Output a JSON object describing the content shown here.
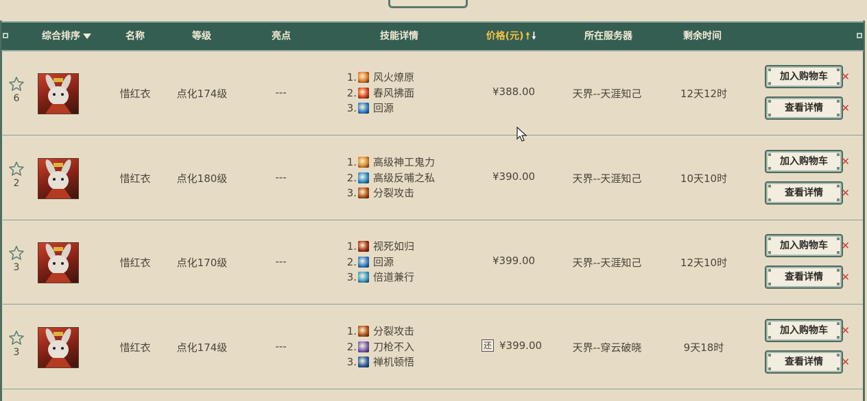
{
  "table": {
    "headers": {
      "sort": "综合排序",
      "name": "名称",
      "level": "等级",
      "highlight": "亮点",
      "skills": "技能详情",
      "price": "价格(元)",
      "server": "所在服务器",
      "remaining": "剩余时间"
    },
    "sort_icons": {
      "sort_dropdown": "caret-down-icon",
      "price_up": "arrow-up-icon",
      "price_down": "arrow-down-icon"
    },
    "accent_colors": {
      "header_bg": "#355e52",
      "price_header": "#f4c344",
      "tick": "#d03b2b"
    },
    "rows": [
      {
        "fav_count": "6",
        "name": "惜红衣",
        "level": "点化174级",
        "highlight": "---",
        "skills": [
          {
            "num": "1.",
            "name": "风火燎原",
            "icon": "fire-wind-skill-icon",
            "color": "#e07a2a"
          },
          {
            "num": "2.",
            "name": "春风拂面",
            "icon": "flame-skill-icon",
            "color": "#d9451d"
          },
          {
            "num": "3.",
            "name": "回源",
            "icon": "orb-skill-icon",
            "color": "#2f7fd0"
          }
        ],
        "returnable": "",
        "price": "¥388.00",
        "server": "天界--天涯知己",
        "remaining": "12天12时",
        "add_cart": "加入购物车",
        "view": "查看详情"
      },
      {
        "fav_count": "2",
        "name": "惜红衣",
        "level": "点化180级",
        "highlight": "---",
        "skills": [
          {
            "num": "1.",
            "name": "高级神工鬼力",
            "icon": "fist-skill-icon",
            "color": "#e0872f"
          },
          {
            "num": "2.",
            "name": "高级反哺之私",
            "icon": "water-skill-icon",
            "color": "#2a8fd8"
          },
          {
            "num": "3.",
            "name": "分裂攻击",
            "icon": "split-attack-skill-icon",
            "color": "#b3541a"
          }
        ],
        "returnable": "",
        "price": "¥390.00",
        "server": "天界--天涯知己",
        "remaining": "10天10时",
        "add_cart": "加入购物车",
        "view": "查看详情"
      },
      {
        "fav_count": "3",
        "name": "惜红衣",
        "level": "点化170级",
        "highlight": "---",
        "skills": [
          {
            "num": "1.",
            "name": "视死如归",
            "icon": "skull-skill-icon",
            "color": "#a8321e"
          },
          {
            "num": "2.",
            "name": "回源",
            "icon": "orb-skill-icon",
            "color": "#2f7fd0"
          },
          {
            "num": "3.",
            "name": "倍道兼行",
            "icon": "speed-skill-icon",
            "color": "#3a9fd0"
          }
        ],
        "returnable": "",
        "price": "¥399.00",
        "server": "天界--天涯知己",
        "remaining": "12天10时",
        "add_cart": "加入购物车",
        "view": "查看详情"
      },
      {
        "fav_count": "3",
        "name": "惜红衣",
        "level": "点化174级",
        "highlight": "---",
        "skills": [
          {
            "num": "1.",
            "name": "分裂攻击",
            "icon": "split-attack-skill-icon",
            "color": "#b3541a"
          },
          {
            "num": "2.",
            "name": "刀枪不入",
            "icon": "shield-skill-icon",
            "color": "#7b5fb8"
          },
          {
            "num": "3.",
            "name": "禅机顿悟",
            "icon": "meditation-skill-icon",
            "color": "#2b5fa8"
          }
        ],
        "returnable": "还",
        "price": "¥399.00",
        "server": "天界--穿云破晓",
        "remaining": "9天18时",
        "add_cart": "加入购物车",
        "view": "查看详情"
      }
    ]
  }
}
